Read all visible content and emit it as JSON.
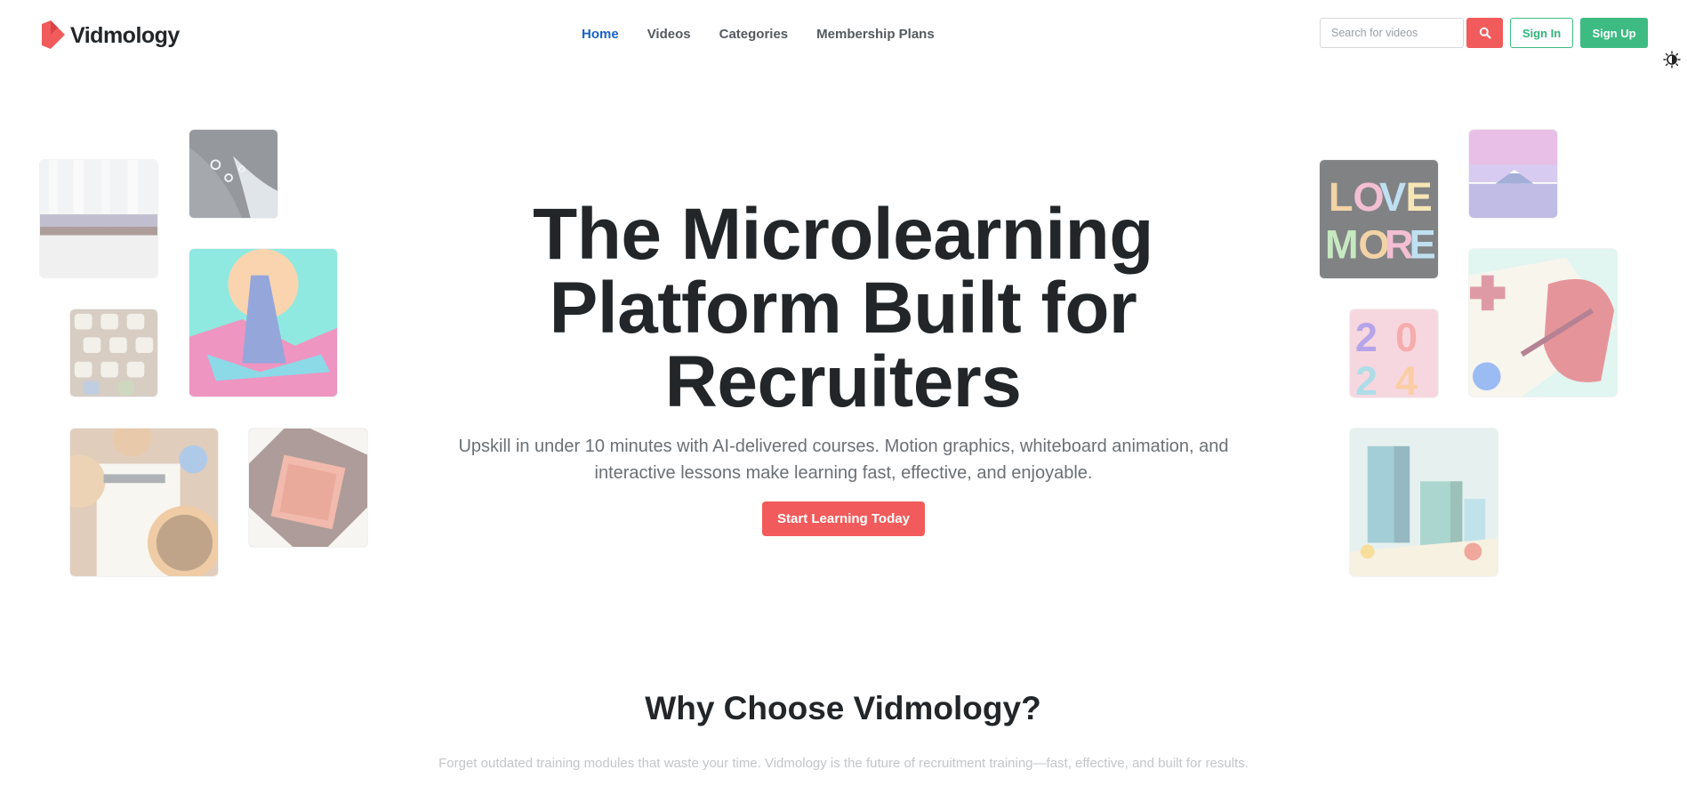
{
  "header": {
    "brand": "Vidmology",
    "nav": [
      {
        "label": "Home",
        "active": true
      },
      {
        "label": "Videos",
        "active": false
      },
      {
        "label": "Categories",
        "active": false
      },
      {
        "label": "Membership Plans",
        "active": false
      }
    ],
    "search": {
      "placeholder": "Search for videos",
      "value": "",
      "icon": "search-icon"
    },
    "signin_label": "Sign In",
    "signup_label": "Sign Up",
    "theme_toggle_icon": "brightness-contrast-icon"
  },
  "hero": {
    "title": "The Microlearning Platform Built for Recruiters",
    "subtitle": "Upskill in under 10 minutes with AI-delivered courses. Motion graphics, whiteboard animation, and interactive lessons make learning fast, effective, and enjoyable.",
    "cta_label": "Start Learning Today"
  },
  "why": {
    "title": "Why Choose Vidmology?",
    "subtitle": "Forget outdated training modules that waste your time. Vidmology is the future of recruitment training—fast, effective, and built for results."
  },
  "colors": {
    "accent_red": "#f15b5b",
    "accent_green": "#3dbb82",
    "nav_active": "#1a63c9",
    "text_dark": "#222629"
  }
}
